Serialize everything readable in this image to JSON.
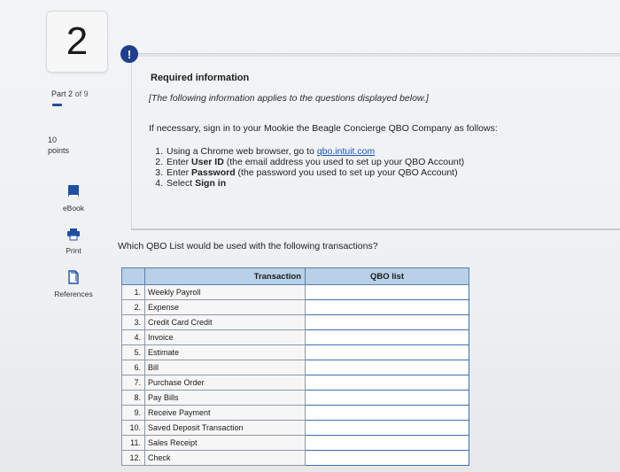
{
  "question_number": "2",
  "part": {
    "label": "Part",
    "current": "2",
    "of_label": "of",
    "total": "9"
  },
  "points": {
    "value": "10",
    "label": "points"
  },
  "sidebar": {
    "ebook_label": "eBook",
    "print_label": "Print",
    "references_label": "References"
  },
  "alert_glyph": "!",
  "required": {
    "title": "Required information",
    "subtitle": "[The following information applies to the questions displayed below.]",
    "intro": "If necessary, sign in to your Mookie the Beagle Concierge QBO Company as follows:",
    "steps": [
      {
        "num": "1.",
        "before": "Using a Chrome web browser, go to ",
        "link": "qbo.intuit.com",
        "bold": "",
        "after": ""
      },
      {
        "num": "2.",
        "before": "Enter ",
        "link": "",
        "bold": "User ID",
        "after": " (the email address you used to set up your QBO Account)"
      },
      {
        "num": "3.",
        "before": "Enter ",
        "link": "",
        "bold": "Password",
        "after": " (the password you used to set up your QBO Account)"
      },
      {
        "num": "4.",
        "before": "Select ",
        "link": "",
        "bold": "Sign in",
        "after": ""
      }
    ]
  },
  "question_text": "Which QBO List would be used with the following transactions?",
  "table": {
    "headers": [
      "",
      "Transaction",
      "QBO list"
    ],
    "rows": [
      {
        "num": "1.",
        "transaction": "Weekly Payroll",
        "answer": ""
      },
      {
        "num": "2.",
        "transaction": "Expense",
        "answer": ""
      },
      {
        "num": "3.",
        "transaction": "Credit Card Credit",
        "answer": ""
      },
      {
        "num": "4.",
        "transaction": "Invoice",
        "answer": ""
      },
      {
        "num": "5.",
        "transaction": "Estimate",
        "answer": ""
      },
      {
        "num": "6.",
        "transaction": "Bill",
        "answer": ""
      },
      {
        "num": "7.",
        "transaction": "Purchase Order",
        "answer": ""
      },
      {
        "num": "8.",
        "transaction": "Pay Bills",
        "answer": ""
      },
      {
        "num": "9.",
        "transaction": "Receive Payment",
        "answer": ""
      },
      {
        "num": "10.",
        "transaction": "Saved Deposit Transaction",
        "answer": ""
      },
      {
        "num": "11.",
        "transaction": "Sales Receipt",
        "answer": ""
      },
      {
        "num": "12.",
        "transaction": "Check",
        "answer": ""
      }
    ]
  },
  "colors": {
    "accent": "#1e3f8f",
    "table_header": "#b8d0e8",
    "link": "#1a55b8"
  },
  "icons": {
    "ebook": "book-icon",
    "print": "printer-icon",
    "references": "document-icon",
    "alert": "exclamation-icon"
  }
}
